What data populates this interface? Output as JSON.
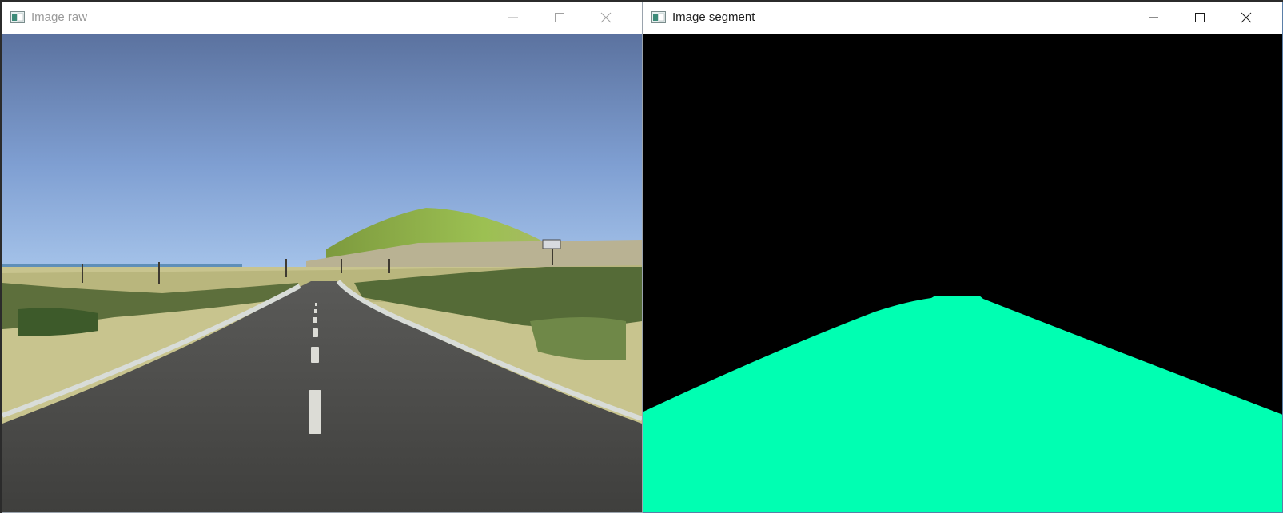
{
  "windows": {
    "raw": {
      "title": "Image raw",
      "icon": "opencv-window-icon",
      "controls": [
        "minimize-icon",
        "maximize-icon",
        "close-icon"
      ],
      "state": "inactive"
    },
    "segment": {
      "title": "Image segment",
      "icon": "opencv-window-icon",
      "controls": [
        "minimize-icon",
        "maximize-icon",
        "close-icon"
      ],
      "state": "active"
    }
  },
  "colors": {
    "segment_background": "#000000",
    "segment_road": "#00ffb2",
    "sky_top": "#5d77a3",
    "sky_bottom": "#8fb4e0",
    "asphalt": "#4a4a48",
    "grass": "#c8c48e"
  }
}
